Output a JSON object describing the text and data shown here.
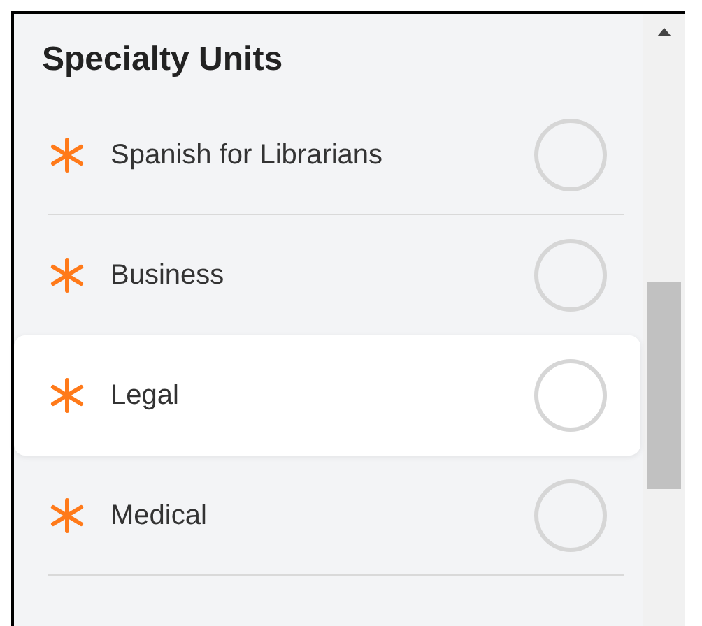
{
  "section": {
    "title": "Specialty Units"
  },
  "units": [
    {
      "label": "Spanish for Librarians",
      "selected": false,
      "highlighted": false
    },
    {
      "label": "Business",
      "selected": false,
      "highlighted": false
    },
    {
      "label": "Legal",
      "selected": false,
      "highlighted": true
    },
    {
      "label": "Medical",
      "selected": false,
      "highlighted": false
    }
  ]
}
